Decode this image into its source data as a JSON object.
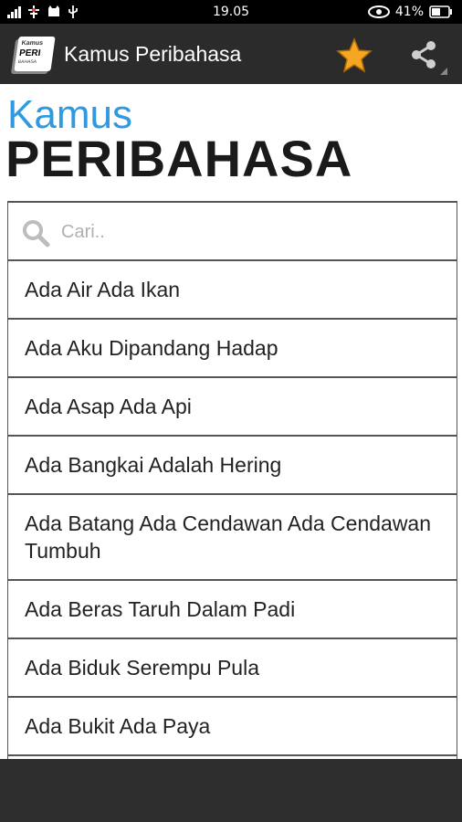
{
  "status_bar": {
    "time": "19.05",
    "battery": "41%"
  },
  "action_bar": {
    "logo": {
      "line1": "Kamus",
      "line2": "PERI",
      "line3": "BAHASA"
    },
    "title": "Kamus Peribahasa",
    "icons": [
      "star-icon",
      "share-icon"
    ],
    "colors": {
      "background": "#2b2b2b",
      "star": "#f5a623"
    }
  },
  "header": {
    "small": "Kamus",
    "big": "PERIBAHASA",
    "colors": {
      "small": "#2f9ae0",
      "big": "#1a1a1a"
    }
  },
  "search": {
    "placeholder": "Cari.."
  },
  "list": {
    "items": [
      "Ada Air Ada Ikan",
      "Ada Aku Dipandang Hadap",
      "Ada Asap Ada Api",
      "Ada Bangkai Adalah Hering",
      "Ada Batang Ada Cendawan Ada Cendawan Tumbuh",
      "Ada Beras Taruh Dalam Padi",
      "Ada Biduk Serempu Pula",
      "Ada Bukit Ada Paya"
    ]
  }
}
